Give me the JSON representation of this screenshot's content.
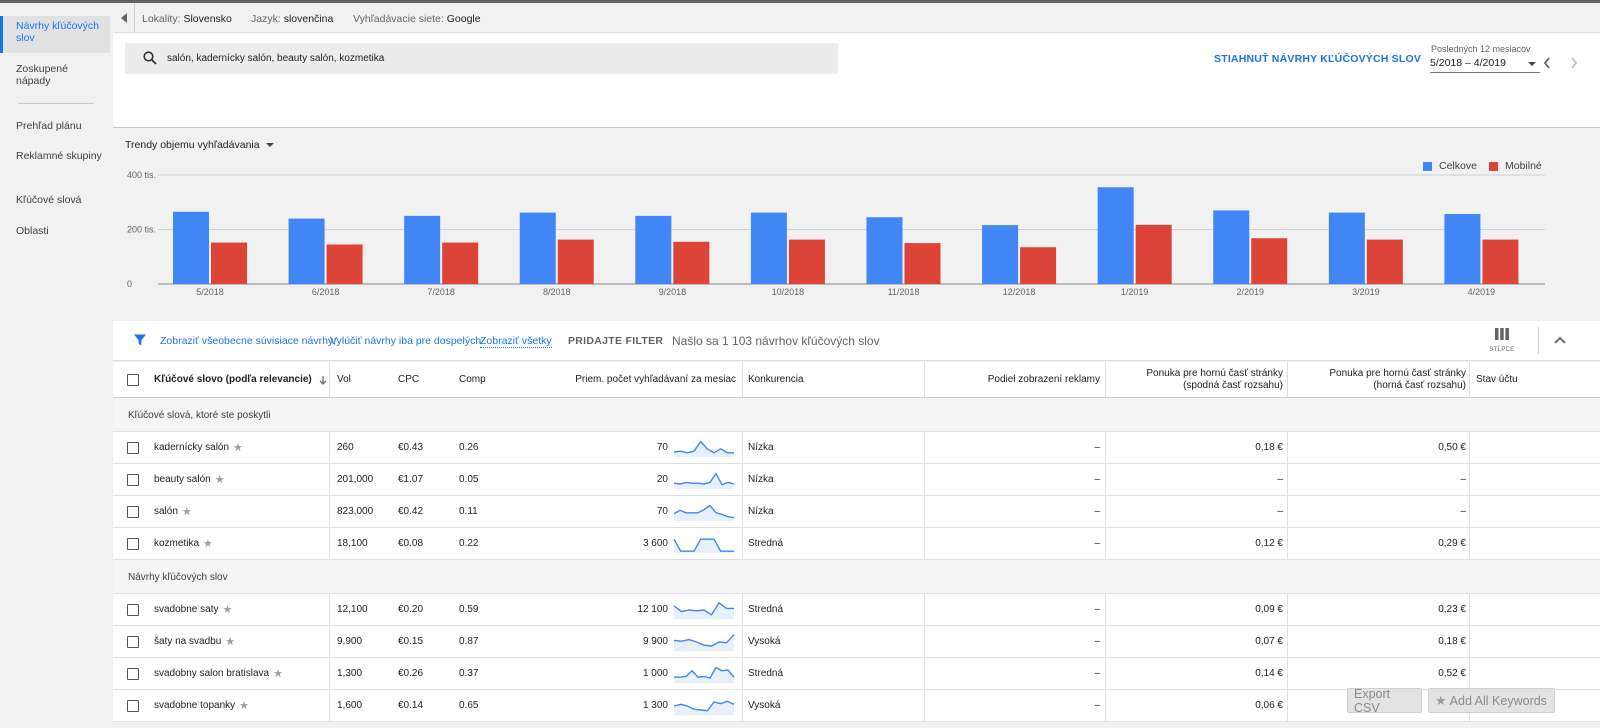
{
  "sidebar": {
    "items": [
      {
        "label": "Návrhy kľúčových slov",
        "active": true
      },
      {
        "label": "Zoskupené nápady"
      },
      {
        "label": "Prehľad plánu"
      },
      {
        "label": "Reklamné skupiny"
      },
      {
        "label": "Kľúčové slová"
      },
      {
        "label": "Oblasti"
      }
    ]
  },
  "topbar": {
    "location_label": "Lokality:",
    "location_value": "Slovensko",
    "language_label": "Jazyk:",
    "language_value": "slovenčina",
    "network_label": "Vyhľadávacie siete:",
    "network_value": "Google"
  },
  "search": {
    "query": "salón, kadernícky salón, beauty salón, kozmetika",
    "download_label": "STIAHNUŤ NÁVRHY KĽÚČOVÝCH SLOV",
    "range_label": "Posledných 12 mesiacov",
    "range_value": "5/2018 – 4/2019"
  },
  "chart": {
    "dropdown_label": "Trendy objemu vyhľadávania",
    "colors": {
      "total": "#4285f4",
      "mobile": "#db4437"
    }
  },
  "chart_data": {
    "type": "bar",
    "categories": [
      "5/2018",
      "6/2018",
      "7/2018",
      "8/2018",
      "9/2018",
      "10/2018",
      "11/2018",
      "12/2018",
      "1/2019",
      "2/2019",
      "3/2019",
      "4/2019"
    ],
    "series": [
      {
        "name": "Celkove",
        "values": [
          265,
          240,
          250,
          262,
          250,
          262,
          245,
          216,
          355,
          270,
          262,
          257
        ]
      },
      {
        "name": "Mobilné",
        "values": [
          152,
          145,
          152,
          163,
          155,
          163,
          150,
          135,
          217,
          168,
          163,
          163
        ]
      }
    ],
    "ylim": [
      0,
      400
    ],
    "yticks": [
      0,
      200,
      400
    ],
    "ytick_labels": [
      "0",
      "200 tis.",
      "400 tis."
    ],
    "legend_position": "top-right",
    "grid": true
  },
  "filter": {
    "link1": "Zobraziť všeobecne súvisiace návrhy;",
    "link2": "Vylúčiť návrhy iba pre dospelých",
    "show_all": "Zobraziť všetky",
    "add_filter": "PRIDAJTE FILTER",
    "count": "Našlo sa 1 103 návrhov kľúčových slov",
    "columns_label": "STĹPCE"
  },
  "table": {
    "headers": {
      "keyword": "Kľúčové slovo (podľa relevancie)",
      "vol": "Vol",
      "cpc": "CPC",
      "comp": "Comp",
      "avg": "Priem. počet vyhľadávaní za mesiac",
      "competition": "Konkurencia",
      "share": "Podiel zobrazení reklamy",
      "bid_low": "Ponuka pre hornú časť stránky (spodná časť rozsahu)",
      "bid_high": "Ponuka pre hornú časť stránky (horná časť rozsahu)",
      "status": "Stav účtu"
    },
    "section1": "Kľúčové slová, ktoré ste poskytli",
    "section2": "Návrhy kľúčových slov",
    "rows1": [
      {
        "kw": "kadernícky salón",
        "vol": "260",
        "cpc": "€0.43",
        "comp": "0.26",
        "avg": "70",
        "competition": "Nízka",
        "share": "–",
        "bid_low": "0,18 €",
        "bid_high": "0,50 €",
        "spark": [
          0.25,
          0.3,
          0.2,
          0.3,
          0.9,
          0.45,
          0.2,
          0.45,
          0.2,
          0.2
        ]
      },
      {
        "kw": "beauty salón",
        "vol": "201,000",
        "cpc": "€1.07",
        "comp": "0.05",
        "avg": "20",
        "competition": "Nízka",
        "share": "–",
        "bid_low": "–",
        "bid_high": "–",
        "spark": [
          0.3,
          0.25,
          0.35,
          0.3,
          0.3,
          0.25,
          0.35,
          0.9,
          0.2,
          0.35,
          0.25
        ]
      },
      {
        "kw": "salón",
        "vol": "823,000",
        "cpc": "€0.42",
        "comp": "0.11",
        "avg": "70",
        "competition": "Nízka",
        "share": "–",
        "bid_low": "–",
        "bid_high": "–",
        "spark": [
          0.4,
          0.6,
          0.45,
          0.45,
          0.45,
          0.65,
          0.9,
          0.45,
          0.35,
          0.2,
          0.15
        ]
      },
      {
        "kw": "kozmetika",
        "vol": "18,100",
        "cpc": "€0.08",
        "comp": "0.22",
        "avg": "3 600",
        "competition": "Stredná",
        "share": "–",
        "bid_low": "0,12 €",
        "bid_high": "0,29 €",
        "spark": [
          0.8,
          0.05,
          0.05,
          0.05,
          0.8,
          0.8,
          0.8,
          0.05,
          0.05,
          0.05
        ]
      }
    ],
    "rows2": [
      {
        "kw": "svadobne saty",
        "vol": "12,100",
        "cpc": "€0.20",
        "comp": "0.59",
        "avg": "12 100",
        "competition": "Stredná",
        "share": "–",
        "bid_low": "0,09 €",
        "bid_high": "0,23 €",
        "spark": [
          0.75,
          0.4,
          0.5,
          0.45,
          0.5,
          0.2,
          0.95,
          0.6,
          0.6
        ]
      },
      {
        "kw": "šaty na svadbu",
        "vol": "9,900",
        "cpc": "€0.15",
        "comp": "0.87",
        "avg": "9 900",
        "competition": "Vysoká",
        "share": "–",
        "bid_low": "0,07 €",
        "bid_high": "0,18 €",
        "spark": [
          0.6,
          0.55,
          0.65,
          0.5,
          0.3,
          0.25,
          0.5,
          0.45,
          0.95
        ]
      },
      {
        "kw": "svadobny salon bratislava",
        "vol": "1,300",
        "cpc": "€0.26",
        "comp": "0.37",
        "avg": "1 000",
        "competition": "Stredná",
        "share": "–",
        "bid_low": "0,14 €",
        "bid_high": "0,52 €",
        "spark": [
          0.3,
          0.3,
          0.35,
          0.7,
          0.3,
          0.35,
          0.25,
          0.9,
          0.7,
          0.75,
          0.3
        ]
      },
      {
        "kw": "svadobne topanky",
        "vol": "1,600",
        "cpc": "€0.14",
        "comp": "0.65",
        "avg": "1 300",
        "competition": "Vysoká",
        "share": "–",
        "bid_low": "0,06 €",
        "bid_high": "",
        "spark": [
          0.5,
          0.6,
          0.5,
          0.3,
          0.25,
          0.2,
          0.75,
          0.65,
          0.8,
          0.6
        ]
      }
    ]
  },
  "buttons": {
    "export": "Export CSV",
    "add_all": "Add All Keywords"
  }
}
